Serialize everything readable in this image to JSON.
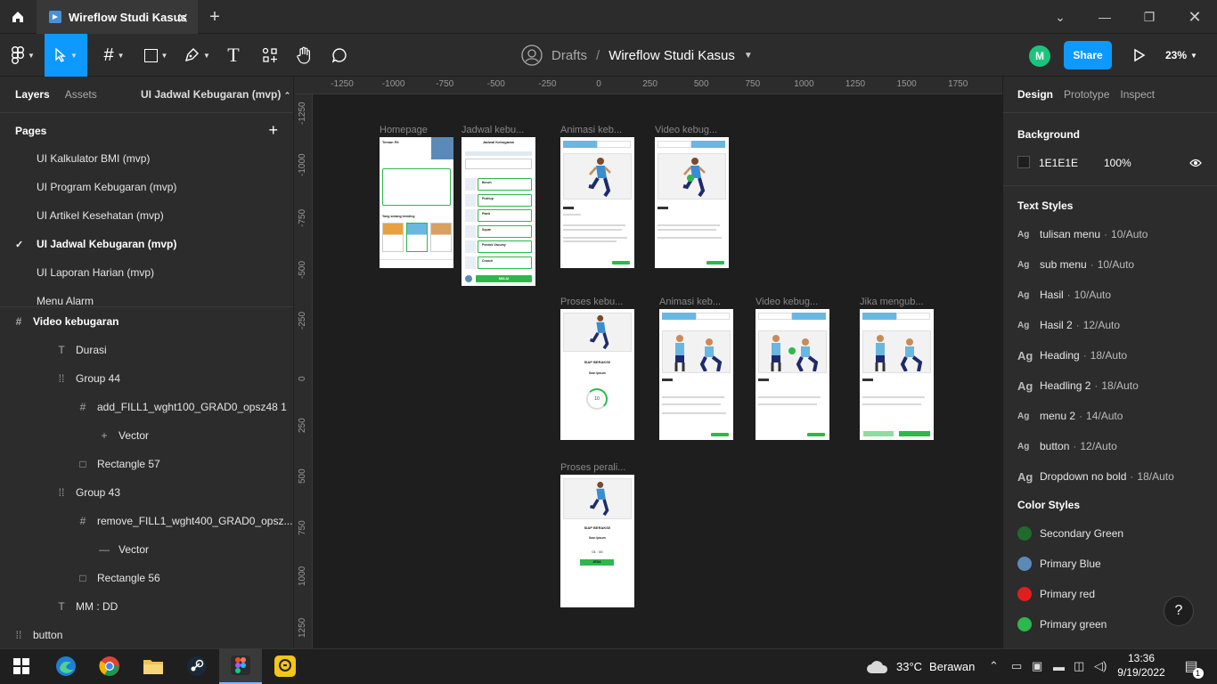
{
  "tab": {
    "file_name": "Wireflow Studi Kasus"
  },
  "breadcrumb": {
    "drafts": "Drafts",
    "sep": "/",
    "file": "Wireflow Studi Kasus"
  },
  "header": {
    "avatar": "M",
    "share": "Share",
    "zoom": "23%"
  },
  "left_panel": {
    "tabs": [
      "Layers",
      "Assets"
    ],
    "current_page": "UI Jadwal Kebugaran (mvp)",
    "pages_title": "Pages",
    "pages": [
      "UI Kalkulator BMI (mvp)",
      "UI Program Kebugaran (mvp)",
      "UI Artikel Kesehatan (mvp)",
      "UI Jadwal Kebugaran (mvp)",
      "UI Laporan Harian (mvp)",
      "Menu Alarm"
    ],
    "active_page_index": 3,
    "layers": [
      {
        "name": "Video kebugaran",
        "icon": "frame-icon",
        "indent": 0,
        "bold": true
      },
      {
        "name": "Durasi",
        "icon": "text-icon",
        "indent": 1
      },
      {
        "name": "Group 44",
        "icon": "group-icon",
        "indent": 1
      },
      {
        "name": "add_FILL1_wght100_GRAD0_opsz48 1",
        "icon": "frame-icon",
        "indent": 2
      },
      {
        "name": "Vector",
        "icon": "plus-vector-icon",
        "indent": 3
      },
      {
        "name": "Rectangle 57",
        "icon": "rectangle-icon",
        "indent": 2
      },
      {
        "name": "Group 43",
        "icon": "group-icon",
        "indent": 1
      },
      {
        "name": "remove_FILL1_wght400_GRAD0_opsz...",
        "icon": "frame-icon",
        "indent": 2
      },
      {
        "name": "Vector",
        "icon": "minus-vector-icon",
        "indent": 3
      },
      {
        "name": "Rectangle 56",
        "icon": "rectangle-icon",
        "indent": 2
      },
      {
        "name": "MM : DD",
        "icon": "text-icon",
        "indent": 1
      },
      {
        "name": "button",
        "icon": "group-icon",
        "indent": 0
      }
    ]
  },
  "canvas": {
    "ruler_x": [
      "-1250",
      "-1000",
      "-750",
      "-500",
      "-250",
      "0",
      "250",
      "500",
      "750",
      "1000",
      "1250",
      "1500",
      "1750"
    ],
    "ruler_y": [
      "-1250",
      "-1000",
      "-750",
      "-500",
      "-250",
      "0",
      "250",
      "500",
      "750",
      "1000",
      "1250"
    ],
    "frame_labels": {
      "homepage": "Homepage",
      "jadwal": "Jadwal kebu...",
      "animasi1": "Animasi keb...",
      "video1": "Video kebug...",
      "proses": "Proses kebu...",
      "animasi2": "Animasi keb...",
      "video2": "Video kebug...",
      "jika": "Jika mengub...",
      "peralihan": "Proses perali..."
    },
    "home": {
      "title": "Teman Fit",
      "section": "Yang sedang trending"
    },
    "jadwal": {
      "title": "Jadwal Kebugaran",
      "items": [
        "Bench",
        "Pushup",
        "Plank",
        "Squat",
        "Pendek Vacumy",
        "Crunch"
      ],
      "button": "MULAI"
    },
    "proses": {
      "title": "SIAP BERAKSI!",
      "sub": "Ikon Ipsum",
      "count": "10"
    },
    "peralihan": {
      "title": "SIAP BERAKSI!",
      "sub": "Ikon Ipsum",
      "timer": "01 : 00",
      "button": "JEDA"
    }
  },
  "right_panel": {
    "tabs": [
      "Design",
      "Prototype",
      "Inspect"
    ],
    "background_title": "Background",
    "bg_hex": "1E1E1E",
    "bg_opacity": "100%",
    "text_styles_title": "Text Styles",
    "text_styles": [
      {
        "name": "tulisan menu",
        "meta": "10/Auto"
      },
      {
        "name": "sub menu",
        "meta": "10/Auto"
      },
      {
        "name": "Hasil",
        "meta": "10/Auto"
      },
      {
        "name": "Hasil 2",
        "meta": "12/Auto"
      },
      {
        "name": "Heading",
        "meta": "18/Auto"
      },
      {
        "name": "Headling 2",
        "meta": "18/Auto"
      },
      {
        "name": "menu 2",
        "meta": "14/Auto"
      },
      {
        "name": "button",
        "meta": "12/Auto"
      },
      {
        "name": "Dropdown no bold",
        "meta": "18/Auto"
      }
    ],
    "color_styles_title": "Color Styles",
    "color_styles": [
      {
        "name": "Secondary Green",
        "color": "#1e6b2b"
      },
      {
        "name": "Primary Blue",
        "color": "#5b8ab8"
      },
      {
        "name": "Primary red",
        "color": "#e01e1e"
      },
      {
        "name": "Primary green",
        "color": "#2db84b"
      }
    ],
    "help": "?"
  },
  "taskbar": {
    "weather_temp": "33°C",
    "weather_text": "Berawan",
    "time": "13:36",
    "date": "9/19/2022",
    "notifications": "1"
  },
  "colors": {
    "accent": "#0d99ff",
    "canvas_bg": "#1e1e1e",
    "panel_bg": "#2c2c2c",
    "green": "#2db84b",
    "avatar": "#1bc47d"
  }
}
